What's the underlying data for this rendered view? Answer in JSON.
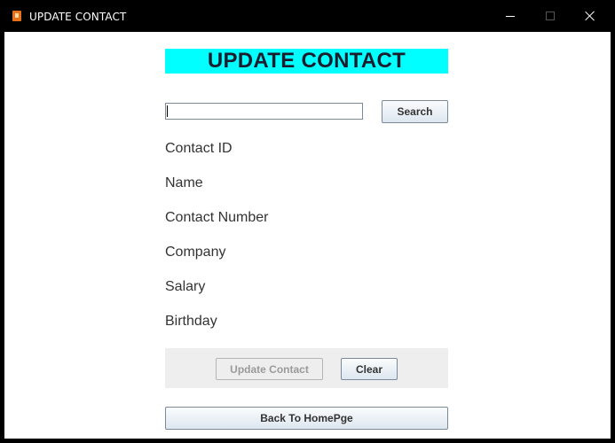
{
  "window": {
    "title": "UPDATE CONTACT"
  },
  "heading": {
    "text": "UPDATE CONTACT",
    "background_color": "#00ffff"
  },
  "search": {
    "value": "",
    "button_label": "Search"
  },
  "fields": [
    {
      "label": "Contact ID"
    },
    {
      "label": "Name"
    },
    {
      "label": "Contact Number"
    },
    {
      "label": "Company"
    },
    {
      "label": "Salary"
    },
    {
      "label": "Birthday"
    }
  ],
  "actions": {
    "update_label": "Update Contact",
    "update_enabled": false,
    "clear_label": "Clear",
    "back_label": "Back To HomePge"
  },
  "icons": {
    "app": "java-app-icon",
    "minimize": "minimize-icon",
    "maximize": "maximize-icon",
    "close": "close-icon"
  }
}
